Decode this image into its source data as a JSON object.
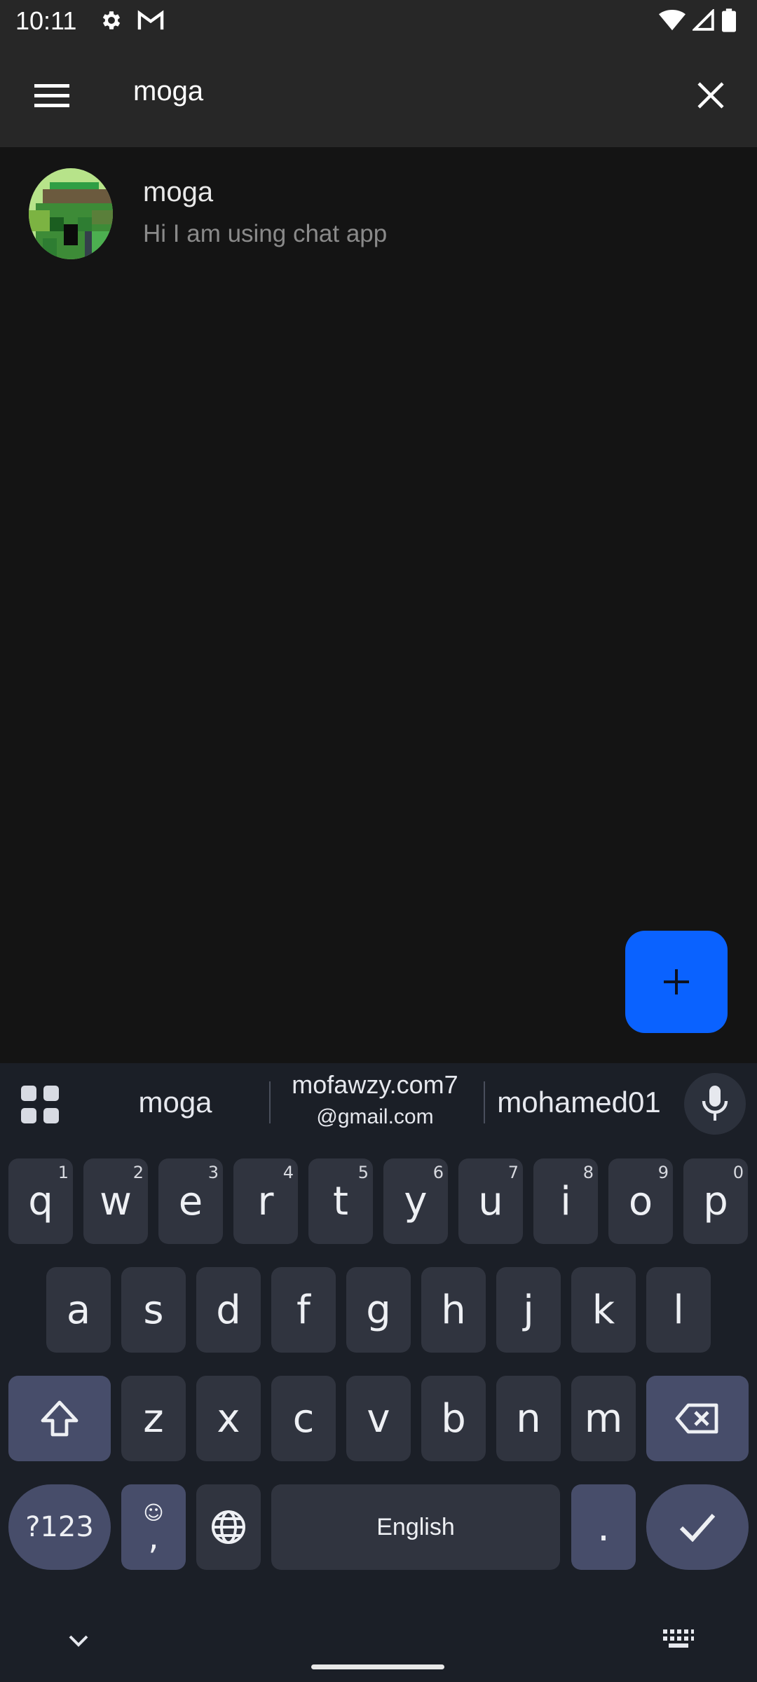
{
  "status_bar": {
    "time": "10:11",
    "left_icons": [
      "gear-icon",
      "gmail-icon"
    ],
    "right_icons": [
      "wifi-icon",
      "cell-signal-icon",
      "battery-icon"
    ]
  },
  "app_bar": {
    "menu_icon": "hamburger-menu-icon",
    "search_value": "moga",
    "clear_icon": "close-icon"
  },
  "results": [
    {
      "name": "moga",
      "status": "Hi I am using chat app",
      "avatar": "pixel-art-avatar"
    }
  ],
  "fab": {
    "icon": "plus-icon",
    "color": "#0a62ff"
  },
  "keyboard": {
    "suggestions": {
      "first": "moga",
      "second_line1": "mofawzy.com7",
      "second_line2": "@gmail.com",
      "third": "mohamed01"
    },
    "row1": [
      {
        "key": "q",
        "hint": "1"
      },
      {
        "key": "w",
        "hint": "2"
      },
      {
        "key": "e",
        "hint": "3"
      },
      {
        "key": "r",
        "hint": "4"
      },
      {
        "key": "t",
        "hint": "5"
      },
      {
        "key": "y",
        "hint": "6"
      },
      {
        "key": "u",
        "hint": "7"
      },
      {
        "key": "i",
        "hint": "8"
      },
      {
        "key": "o",
        "hint": "9"
      },
      {
        "key": "p",
        "hint": "0"
      }
    ],
    "row2": [
      "a",
      "s",
      "d",
      "f",
      "g",
      "h",
      "j",
      "k",
      "l"
    ],
    "row3": [
      "z",
      "x",
      "c",
      "v",
      "b",
      "n",
      "m"
    ],
    "symbols_label": "?123",
    "comma_label": ",",
    "emoji_hint": "☺",
    "space_label": "English",
    "period_label": ".",
    "bottom_icons": [
      "keyboard-hide-icon",
      "keyboard-switch-icon"
    ]
  }
}
